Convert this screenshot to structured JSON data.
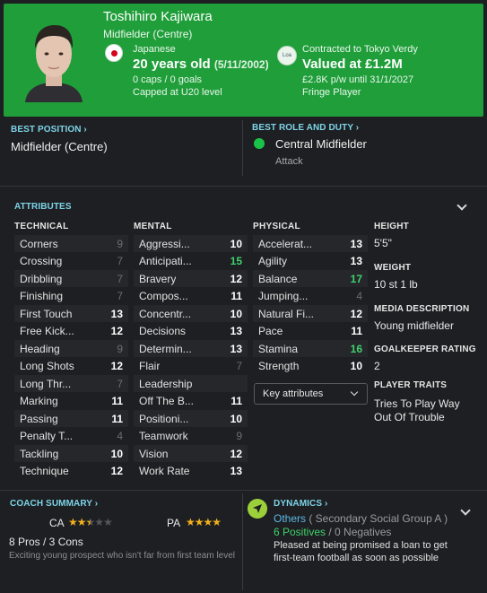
{
  "player": {
    "name": "Toshihiro Kajiwara",
    "position": "Midfielder (Centre)",
    "nationality": "Japanese",
    "age": "20 years old",
    "dob": "(5/11/2002)",
    "caps": "0 caps / 0 goals",
    "capped": "Capped at U20 level",
    "loan_badge": "Loa",
    "contract": "Contracted to Tokyo Verdy",
    "value": "Valued at £1.2M",
    "wage": "£2.8K p/w until 31/1/2027",
    "status": "Fringe Player"
  },
  "best_position": {
    "label": "BEST POSITION",
    "value": "Midfielder (Centre)"
  },
  "best_role": {
    "label": "BEST ROLE AND DUTY",
    "role": "Central Midfielder",
    "duty": "Attack"
  },
  "attributes": {
    "title": "ATTRIBUTES",
    "technical_header": "TECHNICAL",
    "mental_header": "MENTAL",
    "physical_header": "PHYSICAL",
    "technical": [
      {
        "name": "Corners",
        "value": "9"
      },
      {
        "name": "Crossing",
        "value": "7"
      },
      {
        "name": "Dribbling",
        "value": "7"
      },
      {
        "name": "Finishing",
        "value": "7"
      },
      {
        "name": "First Touch",
        "value": "13"
      },
      {
        "name": "Free Kick...",
        "value": "12"
      },
      {
        "name": "Heading",
        "value": "9"
      },
      {
        "name": "Long Shots",
        "value": "12"
      },
      {
        "name": "Long Thr...",
        "value": "7"
      },
      {
        "name": "Marking",
        "value": "11"
      },
      {
        "name": "Passing",
        "value": "11"
      },
      {
        "name": "Penalty T...",
        "value": "4"
      },
      {
        "name": "Tackling",
        "value": "10"
      },
      {
        "name": "Technique",
        "value": "12"
      }
    ],
    "mental": [
      {
        "name": "Aggressi...",
        "value": "10"
      },
      {
        "name": "Anticipati...",
        "value": "15"
      },
      {
        "name": "Bravery",
        "value": "12"
      },
      {
        "name": "Compos...",
        "value": "11"
      },
      {
        "name": "Concentr...",
        "value": "10"
      },
      {
        "name": "Decisions",
        "value": "13"
      },
      {
        "name": "Determin...",
        "value": "13"
      },
      {
        "name": "Flair",
        "value": "7"
      },
      {
        "name": "Leadership",
        "value": ""
      },
      {
        "name": "Off The B...",
        "value": "11"
      },
      {
        "name": "Positioni...",
        "value": "10"
      },
      {
        "name": "Teamwork",
        "value": "9"
      },
      {
        "name": "Vision",
        "value": "12"
      },
      {
        "name": "Work Rate",
        "value": "13"
      }
    ],
    "physical": [
      {
        "name": "Accelerat...",
        "value": "13"
      },
      {
        "name": "Agility",
        "value": "13"
      },
      {
        "name": "Balance",
        "value": "17"
      },
      {
        "name": "Jumping...",
        "value": "4"
      },
      {
        "name": "Natural Fi...",
        "value": "12"
      },
      {
        "name": "Pace",
        "value": "11"
      },
      {
        "name": "Stamina",
        "value": "16"
      },
      {
        "name": "Strength",
        "value": "10"
      }
    ],
    "key_attributes_label": "Key attributes"
  },
  "info": {
    "height_label": "HEIGHT",
    "height": "5'5\"",
    "weight_label": "WEIGHT",
    "weight": "10 st 1 lb",
    "media_label": "MEDIA DESCRIPTION",
    "media": "Young midfielder",
    "gk_label": "GOALKEEPER RATING",
    "gk": "2",
    "traits_label": "PLAYER TRAITS",
    "traits_line1": "Tries To Play Way",
    "traits_line2": "Out Of Trouble"
  },
  "coach": {
    "title": "COACH SUMMARY",
    "ca_label": "CA",
    "ca_stars": 2.5,
    "pa_label": "PA",
    "pa_stars": 4,
    "pros_cons": "8 Pros / 3 Cons",
    "description": "Exciting young prospect who isn't far from first team level"
  },
  "dynamics": {
    "title": "DYNAMICS",
    "group_name": "Others",
    "group_detail": " ( Secondary Social Group A )",
    "positives": "6 Positives",
    "separator": " / ",
    "negatives": "0 Negatives",
    "description": "Pleased at being promised a loan to get first-team football as soon as possible"
  },
  "colors": {
    "header_green": "#1f9e3a",
    "link_cyan": "#7cd4e8",
    "high_value_green": "#3fd16b",
    "star_gold": "#f2b01e",
    "background": "#1e1f22"
  }
}
